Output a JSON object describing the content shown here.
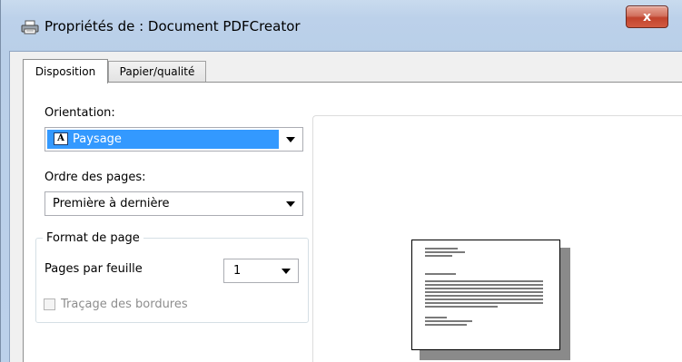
{
  "window": {
    "title": "Propriétés de : Document PDFCreator",
    "close_label": "x"
  },
  "tabs": [
    {
      "label": "Disposition",
      "active": true
    },
    {
      "label": "Papier/qualité",
      "active": false
    }
  ],
  "orientation": {
    "label": "Orientation:",
    "value": "Paysage",
    "icon": "landscape-orientation-icon"
  },
  "page_order": {
    "label": "Ordre des pages:",
    "value": "Première à dernière"
  },
  "page_format": {
    "group_label": "Format de page",
    "pages_per_sheet_label": "Pages par feuille",
    "pages_per_sheet_value": "1",
    "border_label": "Traçage des bordures",
    "border_checked": false,
    "border_enabled": false
  },
  "colors": {
    "selection": "#3399ff",
    "close_button": "#c1432d",
    "disabled_text": "#8d8d8d"
  }
}
